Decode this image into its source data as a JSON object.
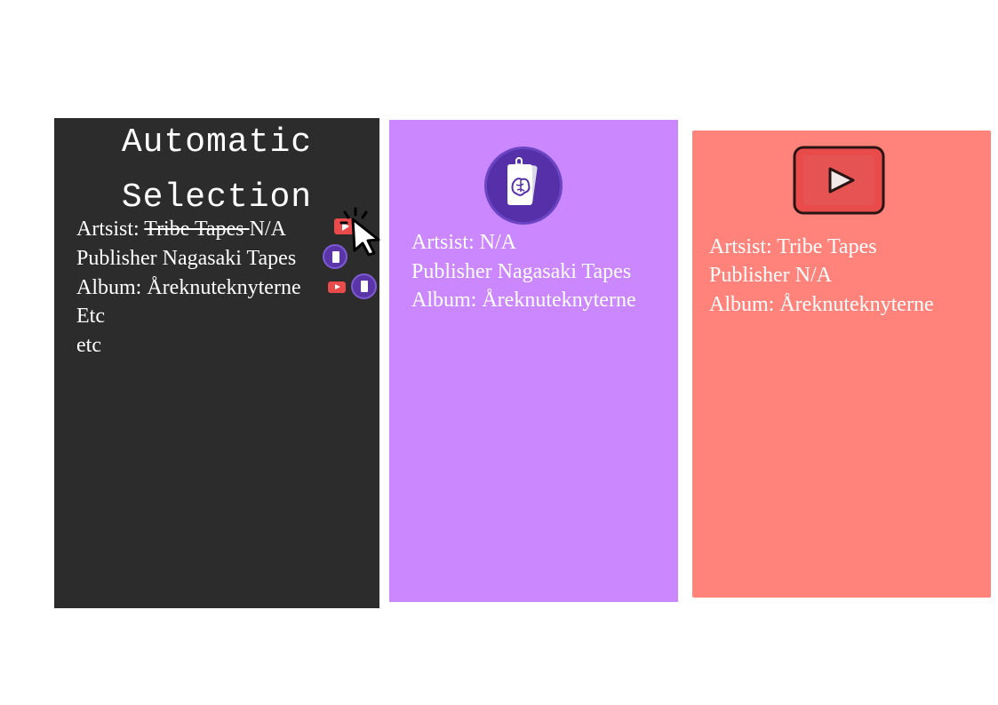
{
  "automatic": {
    "title_line1": "Automatic",
    "title_line2": "Selection",
    "artist_prefix": "Artsist: ",
    "artist_struck": "Tribe Tapes ",
    "artist_value": "N/A",
    "publisher": "Publisher Nagasaki Tapes",
    "album": "Album: Åreknuteknyterne",
    "etc_upper": "Etc",
    "etc_lower": "etc"
  },
  "metadata_source": {
    "artist": "Artsist: N/A",
    "publisher": "Publisher Nagasaki Tapes",
    "album": "Album: Åreknuteknyterne"
  },
  "youtube_source": {
    "artist": "Artsist: Tribe Tapes",
    "publisher": "Publisher N/A",
    "album": "Album: Åreknuteknyterne"
  },
  "colors": {
    "automatic_panel": "#2c2c2c",
    "metadata_panel": "#cb87fd",
    "youtube_panel": "#ff837a",
    "youtube_red": "#e94b4b",
    "metadata_purple": "#5a35a8"
  },
  "icons": [
    "youtube-icon",
    "tag-brain-icon",
    "mouse-cursor-icon"
  ]
}
